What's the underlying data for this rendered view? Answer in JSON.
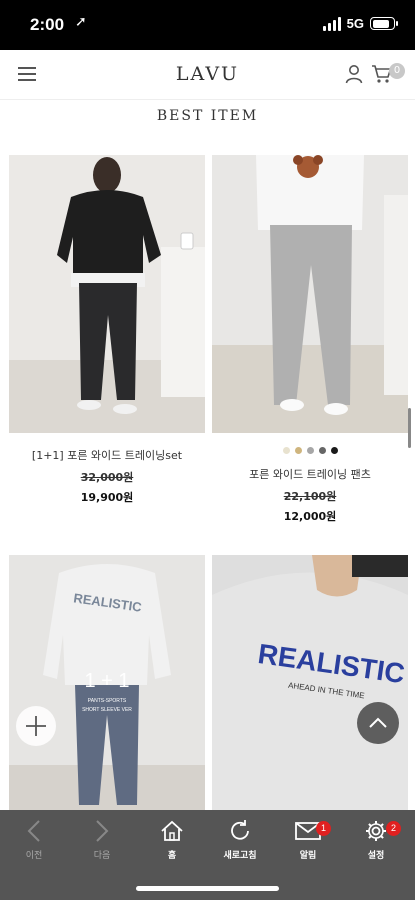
{
  "status_bar": {
    "time": "2:00",
    "location_arrow": "➚",
    "network": "5G",
    "battery_level": 0.8
  },
  "header": {
    "logo": "LAVU",
    "cart_count": "0",
    "icons": [
      "menu-icon",
      "user-icon",
      "cart-icon"
    ]
  },
  "section": {
    "title": "BEST ITEM"
  },
  "products": [
    {
      "name": "[1+1] 포른 와이드 트레이닝set",
      "original_price": "32,000원",
      "sale_price": "19,900원"
    },
    {
      "name": "포른 와이드 트레이닝 팬츠",
      "original_price": "22,100원",
      "sale_price": "12,000원",
      "swatches": [
        "#e8e2cf",
        "#cfb57e",
        "#a7a7a7",
        "#666666",
        "#1a1a1a"
      ]
    },
    {
      "overlay_text": "1 + 1",
      "overlay_sub1": "PANTS-SPORTS",
      "overlay_sub2": "SHORT SLEEVE VER"
    },
    {
      "print_text": "REALISTIC",
      "print_sub": "AHEAD IN THE TIME"
    }
  ],
  "product3_print": "REALISTIC",
  "bottom_nav": {
    "items": [
      {
        "label": "이전",
        "icon": "back-arrow-icon"
      },
      {
        "label": "다음",
        "icon": "forward-arrow-icon"
      },
      {
        "label": "홈",
        "icon": "home-icon"
      },
      {
        "label": "새로고침",
        "icon": "refresh-icon"
      },
      {
        "label": "알림",
        "icon": "mail-icon",
        "badge": "1"
      },
      {
        "label": "설정",
        "icon": "gear-icon",
        "badge": "2"
      }
    ]
  },
  "colors": {
    "nav_bg": "#555555",
    "badge": "#e02020",
    "status_bg": "#000000"
  }
}
